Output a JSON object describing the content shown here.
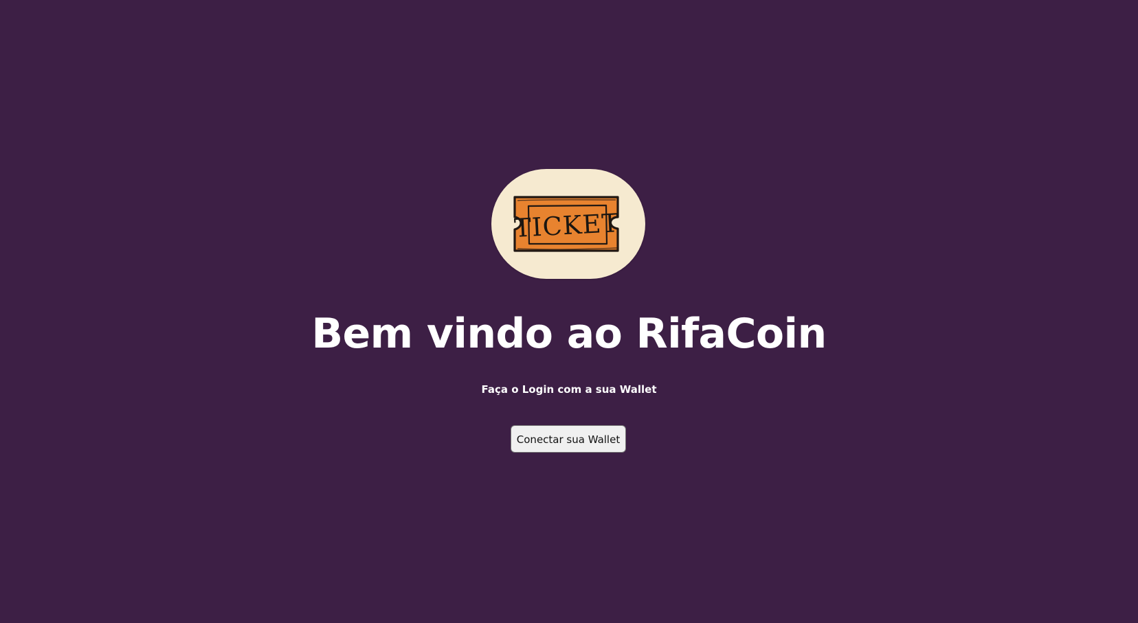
{
  "theme": {
    "background": "#3d1f45",
    "logo_background": "#f6ead0",
    "ticket_color": "#e8832f",
    "text_color": "#ffffff"
  },
  "logo": {
    "icon": "ticket-icon",
    "text": "TICKET"
  },
  "main": {
    "title": "Bem vindo ao RifaCoin",
    "subtitle": "Faça o Login com a sua Wallet",
    "connect_button_label": "Conectar sua Wallet"
  }
}
